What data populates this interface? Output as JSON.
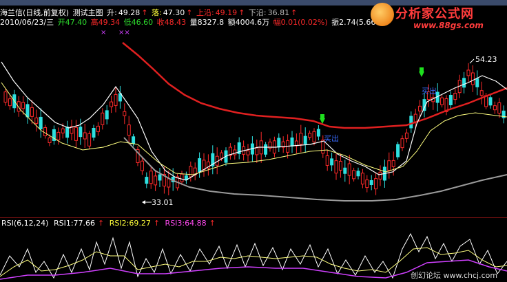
{
  "header": {
    "row1": {
      "title": "海兰信(日线,前复权)",
      "indicator": "测试主图",
      "up_label": "升:",
      "up_value": "49.28",
      "down_label": "落:",
      "down_value": "47.30",
      "upper_label": "上沿:",
      "upper_value": "49.19",
      "lower_label": "下沿:",
      "lower_value": "36.81"
    },
    "row2": {
      "date": "2010/06/23/三",
      "open_label": "开",
      "open": "47.40",
      "high_label": "高",
      "high": "49.34",
      "low_label": "低",
      "low": "46.60",
      "close_label": "收",
      "close": "48.43",
      "volume_label": "量",
      "volume": "8327.8",
      "amount_label": "额",
      "amount": "4004.6万",
      "change_label": "幅",
      "change": "0.01(0.02%)",
      "amplitude_label": "振",
      "amplitude": "2.74(5.66"
    }
  },
  "logo": {
    "name": "分析家公式网",
    "url": "www.88gs.com"
  },
  "chart": {
    "high_label": "54.23",
    "low_label": "33.01",
    "buy_label_1": "买出",
    "buy_label_2": "买出"
  },
  "rsi": {
    "title": "RSI(6,12,24)",
    "rsi1_label": "RSI1:",
    "rsi1": "77.66",
    "rsi2_label": "RSI2:",
    "rsi2": "69.27",
    "rsi3_label": "RSI3:",
    "rsi3": "64.88"
  },
  "watermark": "创幻论坛 www.chcj.com",
  "colors": {
    "up": "#ff2a2a",
    "down": "#2ee0e0",
    "ma_white": "#ffffff",
    "ma_yellow": "#ffff80",
    "ma_red": "#e02020",
    "ma_gray": "#9a9a9a",
    "rsi3": "#d040ff"
  }
}
